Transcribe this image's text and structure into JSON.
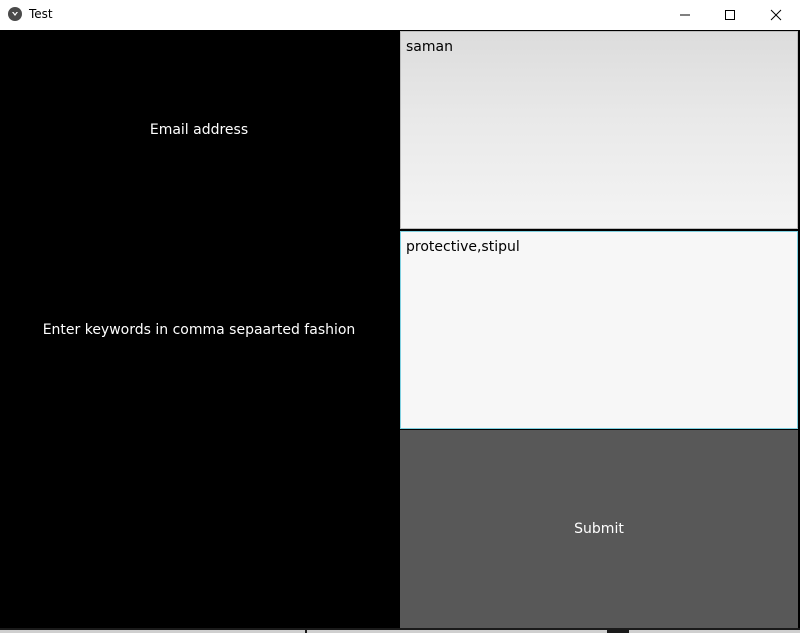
{
  "window": {
    "title": "Test",
    "app_icon": "kivy-icon",
    "controls": {
      "minimize_icon": "minimize-icon",
      "maximize_icon": "maximize-icon",
      "close_icon": "close-icon"
    }
  },
  "form": {
    "email_label": "Email address",
    "email_value": "saman",
    "keywords_label": "Enter keywords in comma sepaarted fashion",
    "keywords_value": "protective,stipul",
    "submit_label": "Submit"
  },
  "colors": {
    "background": "#000000",
    "submit_bg": "#585858",
    "focus_border": "#7fd0e0"
  }
}
